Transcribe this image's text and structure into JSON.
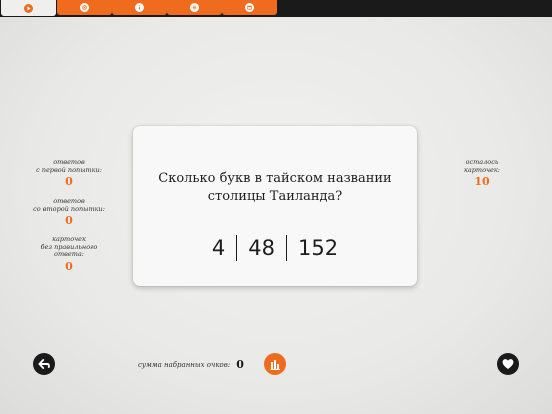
{
  "tabs": [
    {
      "icon": "play-icon",
      "active": true
    },
    {
      "icon": "gear-icon",
      "active": false
    },
    {
      "icon": "info-icon",
      "active": false
    },
    {
      "icon": "list-icon",
      "active": false
    },
    {
      "icon": "store-icon",
      "active": false
    }
  ],
  "stats_left": [
    {
      "label": "ответов\nс первой попытки:",
      "value": "0"
    },
    {
      "label": "ответов\nсо второй попытки:",
      "value": "0"
    },
    {
      "label": "карточек\nбез правильного\nответа:",
      "value": "0"
    }
  ],
  "stats_right": {
    "label": "осталось\nкарточек:",
    "value": "10"
  },
  "card": {
    "question": "Сколько букв в тайском названии\nстолицы Таиланда?",
    "answers": [
      "4",
      "48",
      "152"
    ]
  },
  "footer": {
    "score_label": "сумма набранных очков:",
    "score_value": "0"
  },
  "colors": {
    "accent": "#ef6c1e",
    "dark": "#1a1a1a"
  }
}
